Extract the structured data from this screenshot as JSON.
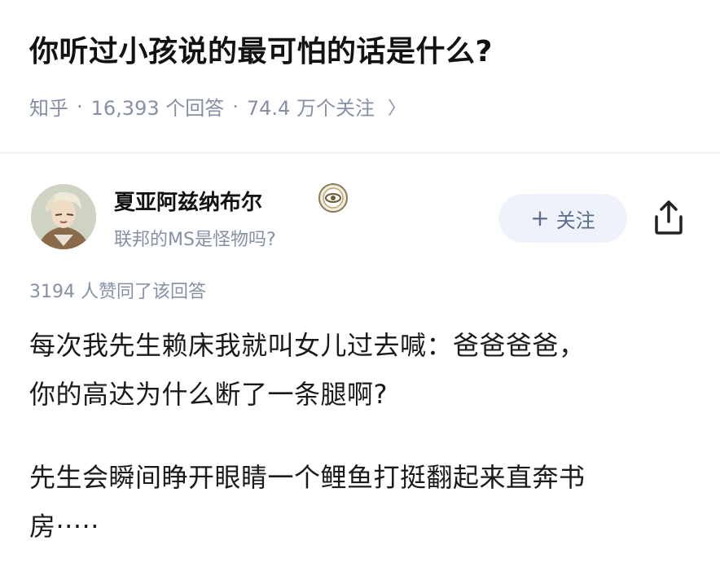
{
  "question": {
    "title": "你听过小孩说的最可怕的话是什么?",
    "source": "知乎",
    "answer_count": "16,393 个回答",
    "follower_count": "74.4 万个关注"
  },
  "author": {
    "name": "夏亚阿兹纳布尔",
    "headline": "联邦的MS是怪物吗?"
  },
  "actions": {
    "follow_label": "关注",
    "follow_plus": "+"
  },
  "answer": {
    "vote_info": "3194 人赞同了该回答",
    "paragraph1_line1": "每次我先生赖床我就叫女儿过去喊：爸爸爸爸，",
    "paragraph1_line2": "你的高达为什么断了一条腿啊?",
    "paragraph2_line1": "先生会瞬间睁开眼睛一个鲤鱼打挺翻起来直奔书",
    "paragraph2_line2": "房·····"
  },
  "colors": {
    "meta_text": "#8590a6",
    "follow_bg": "#eef2fa",
    "divider": "#f2f3f5"
  }
}
